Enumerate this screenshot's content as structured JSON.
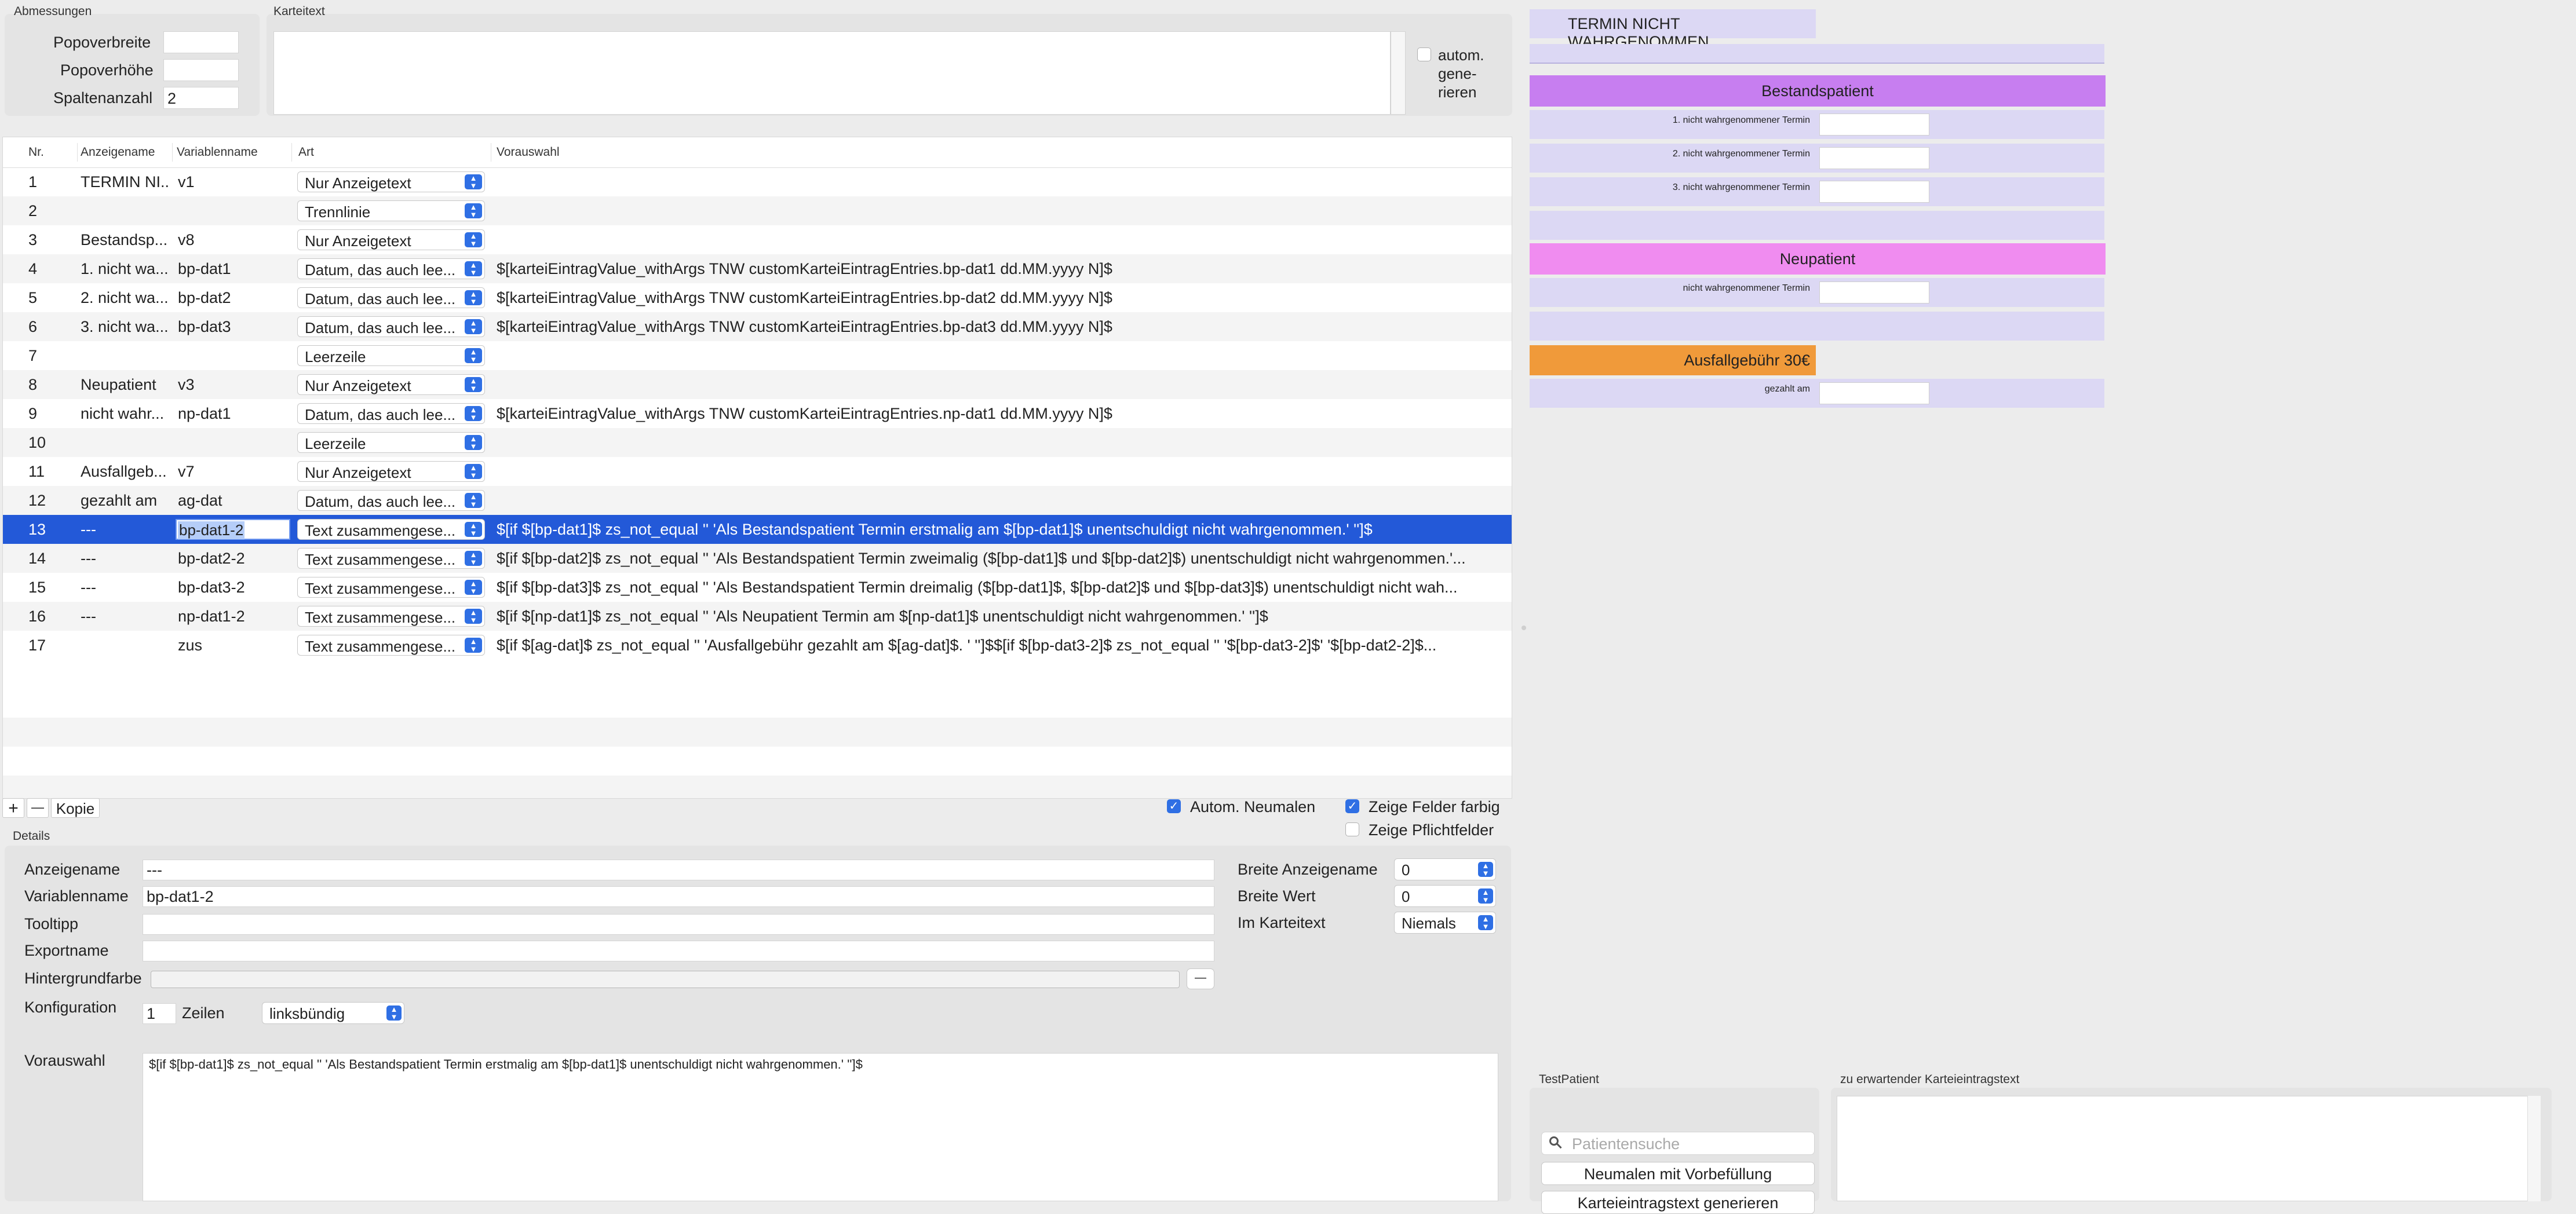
{
  "dimensions": {
    "section_title": "Abmessungen",
    "popover_width_label": "Popoverbreite",
    "popover_width_value": "",
    "popover_height_label": "Popoverhöhe",
    "popover_height_value": "",
    "columns_label": "Spaltenanzahl",
    "columns_value": "2"
  },
  "kartei": {
    "section_title": "Karteitext",
    "text": "",
    "auto_label_1": "autom.",
    "auto_label_2": "gene-",
    "auto_label_3": "rieren"
  },
  "table": {
    "headers": [
      "Nr.",
      "Anzeigename",
      "Variablenname",
      "Art",
      "Vorauswahl"
    ],
    "rows": [
      {
        "nr": "1",
        "name": "TERMIN NI...",
        "var": "v1",
        "art": "Nur Anzeigetext",
        "vor": ""
      },
      {
        "nr": "2",
        "name": "",
        "var": "",
        "art": "Trennlinie",
        "vor": ""
      },
      {
        "nr": "3",
        "name": "Bestandsp...",
        "var": "v8",
        "art": "Nur Anzeigetext",
        "vor": ""
      },
      {
        "nr": "4",
        "name": "1. nicht wa...",
        "var": "bp-dat1",
        "art": "Datum, das auch lee...",
        "vor": "$[karteiEintragValue_withArgs TNW customKarteiEintragEntries.bp-dat1 dd.MM.yyyy N]$"
      },
      {
        "nr": "5",
        "name": "2. nicht wa...",
        "var": "bp-dat2",
        "art": "Datum, das auch lee...",
        "vor": "$[karteiEintragValue_withArgs TNW customKarteiEintragEntries.bp-dat2 dd.MM.yyyy N]$"
      },
      {
        "nr": "6",
        "name": "3. nicht wa...",
        "var": "bp-dat3",
        "art": "Datum, das auch lee...",
        "vor": "$[karteiEintragValue_withArgs TNW customKarteiEintragEntries.bp-dat3 dd.MM.yyyy N]$"
      },
      {
        "nr": "7",
        "name": "",
        "var": "",
        "art": "Leerzeile",
        "vor": ""
      },
      {
        "nr": "8",
        "name": "Neupatient",
        "var": "v3",
        "art": "Nur Anzeigetext",
        "vor": ""
      },
      {
        "nr": "9",
        "name": "nicht wahr...",
        "var": "np-dat1",
        "art": "Datum, das auch lee...",
        "vor": "$[karteiEintragValue_withArgs TNW customKarteiEintragEntries.np-dat1 dd.MM.yyyy N]$"
      },
      {
        "nr": "10",
        "name": "",
        "var": "",
        "art": "Leerzeile",
        "vor": ""
      },
      {
        "nr": "11",
        "name": "Ausfallgeb...",
        "var": "v7",
        "art": "Nur Anzeigetext",
        "vor": ""
      },
      {
        "nr": "12",
        "name": "gezahlt am",
        "var": "ag-dat",
        "art": "Datum, das auch lee...",
        "vor": ""
      },
      {
        "nr": "13",
        "name": "---",
        "var": "bp-dat1-2",
        "art": "Text zusammengese...",
        "vor": "$[if $[bp-dat1]$ zs_not_equal '' 'Als Bestandspatient Termin erstmalig am $[bp-dat1]$ unentschuldigt nicht wahrgenommen.' '']$"
      },
      {
        "nr": "14",
        "name": "---",
        "var": "bp-dat2-2",
        "art": "Text zusammengese...",
        "vor": "$[if $[bp-dat2]$ zs_not_equal '' 'Als Bestandspatient Termin zweimalig ($[bp-dat1]$ und $[bp-dat2]$) unentschuldigt nicht wahrgenommen.'..."
      },
      {
        "nr": "15",
        "name": "---",
        "var": "bp-dat3-2",
        "art": "Text zusammengese...",
        "vor": "$[if $[bp-dat3]$ zs_not_equal '' 'Als Bestandspatient Termin dreimalig ($[bp-dat1]$, $[bp-dat2]$ und $[bp-dat3]$) unentschuldigt nicht wah..."
      },
      {
        "nr": "16",
        "name": "---",
        "var": "np-dat1-2",
        "art": "Text zusammengese...",
        "vor": "$[if $[np-dat1]$ zs_not_equal '' 'Als Neupatient Termin am $[np-dat1]$ unentschuldigt nicht wahrgenommen.' '']$"
      },
      {
        "nr": "17",
        "name": "",
        "var": "zus",
        "art": "Text zusammengese...",
        "vor": "$[if $[ag-dat]$ zs_not_equal '' 'Ausfallgebühr gezahlt am $[ag-dat]$. ' '']$$[if $[bp-dat3-2]$ zs_not_equal '' '$[bp-dat3-2]$' '$[bp-dat2-2]$..."
      }
    ]
  },
  "toolbar": {
    "add": "+",
    "remove": "—",
    "copy": "Kopie",
    "auto_rename": "Autom. Neumalen",
    "show_colored": "Zeige Felder farbig",
    "show_required": "Zeige Pflichtfelder"
  },
  "details": {
    "section_title": "Details",
    "display_name_label": "Anzeigename",
    "display_name_value": "---",
    "var_name_label": "Variablenname",
    "var_name_value": "bp-dat1-2",
    "tooltip_label": "Tooltipp",
    "tooltip_value": "",
    "export_label": "Exportname",
    "export_value": "",
    "bgcolor_label": "Hintergrundfarbe",
    "bgcolor_minus": "—",
    "config_label": "Konfiguration",
    "config_lines_value": "1",
    "config_lines_label": "Zeilen",
    "config_align": "linksbündig",
    "width_name_label": "Breite Anzeigename",
    "width_name_value": "0",
    "width_value_label": "Breite Wert",
    "width_value_value": "0",
    "in_karteitext_label": "Im Karteitext",
    "in_karteitext_value": "Niemals",
    "preselect_label": "Vorauswahl",
    "preselect_value": "$[if $[bp-dat1]$ zs_not_equal '' 'Als Bestandspatient Termin erstmalig am $[bp-dat1]$ unentschuldigt nicht wahrgenommen.' '']$"
  },
  "preview": {
    "title": "TERMIN NICHT WAHRGENOMMEN",
    "section1": "Bestandspatient",
    "bp1_label": "1. nicht wahrgenommener Termin",
    "bp2_label": "2. nicht wahrgenommener Termin",
    "bp3_label": "3. nicht wahrgenommener Termin",
    "section2": "Neupatient",
    "np1_label": "nicht wahrgenommener Termin",
    "fee_label": "Ausfallgebühr 30€",
    "paid_label": "gezahlt am"
  },
  "test": {
    "section_title": "TestPatient",
    "search_placeholder": "Patientensuche",
    "button_render": "Neumalen mit Vorbefüllung",
    "button_generate": "Karteieintragstext generieren",
    "expected_title": "zu erwartender Karteieintragstext"
  },
  "colors": {
    "selection": "#2359d8",
    "preview_row": "#dcd8f4",
    "bestandspatient": "#c77ef0",
    "neupatient": "#f08cf0",
    "fee": "#f09a3a",
    "checkbox_accent": "#2f6fe4"
  }
}
